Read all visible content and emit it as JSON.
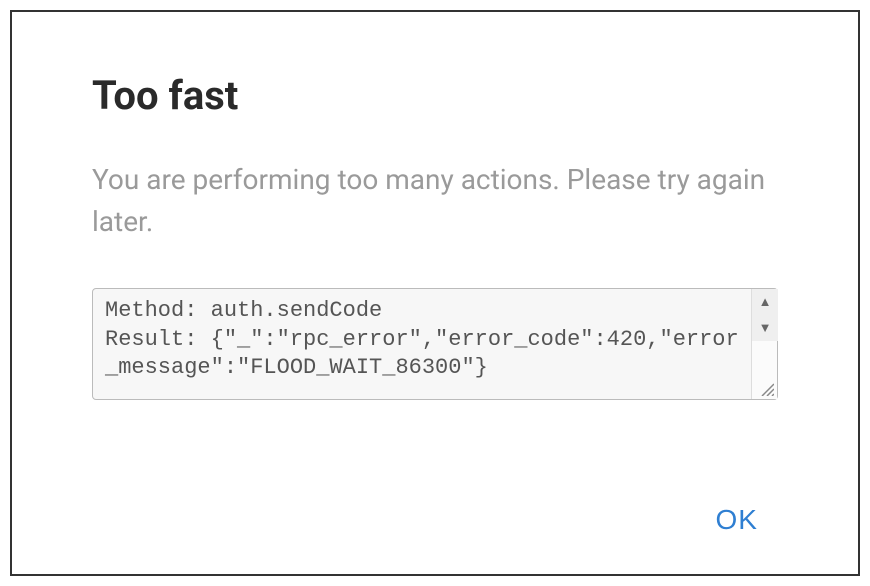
{
  "dialog": {
    "title": "Too fast",
    "message": "You are performing too many actions. Please try again later.",
    "error_text": "Method: auth.sendCode\nResult: {\"_\":\"rpc_error\",\"error_code\":420,\"error_message\":\"FLOOD_WAIT_86300\"}",
    "ok_label": "OK"
  }
}
